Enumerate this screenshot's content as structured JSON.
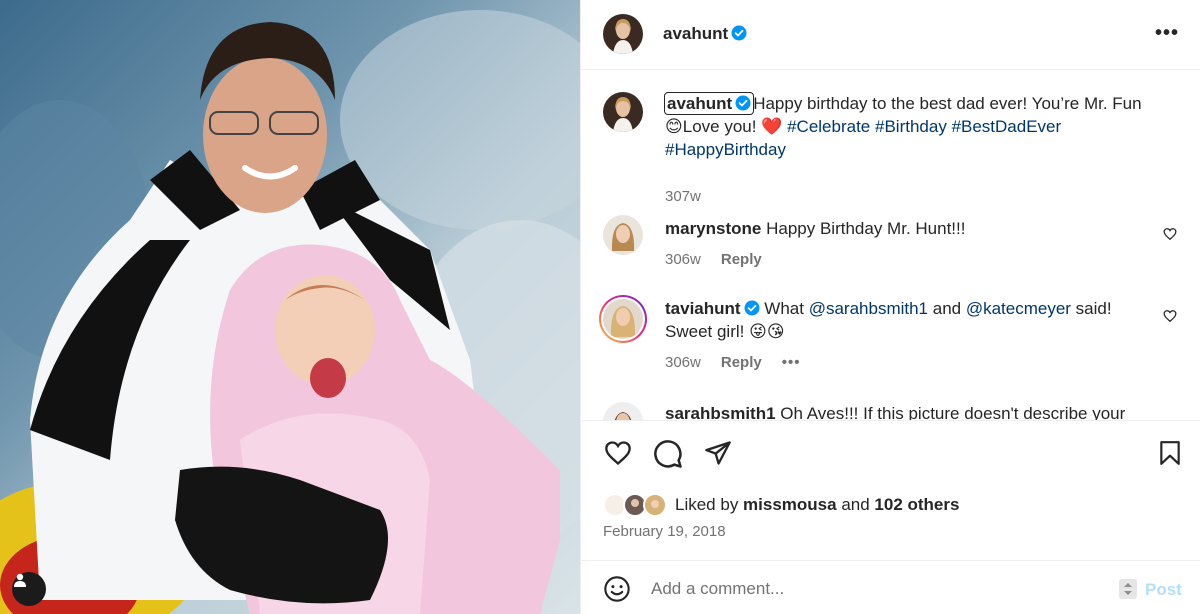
{
  "post": {
    "author": "avahunt",
    "caption_text": "Happy birthday to the best dad ever! You’re Mr. Fun ",
    "caption_emoji1": "😊",
    "caption_text2": "Love you! ",
    "caption_emoji2": "❤️",
    "hashtags": [
      "#Celebrate",
      "#Birthday",
      "#BestDadEver",
      "#HappyBirthday"
    ],
    "age": "307w",
    "liked_by_user": "missmousa",
    "likes_suffix": " and ",
    "likes_count": "102 others",
    "liked_by_prefix": "Liked by ",
    "date": "February 19, 2018"
  },
  "header": {
    "username": "avahunt",
    "more": "•••"
  },
  "comments": [
    {
      "username": "marynstone",
      "text": "Happy Birthday Mr. Hunt!!!",
      "age": "306w",
      "reply": "Reply"
    },
    {
      "username": "taviahunt",
      "text_prefix": "What ",
      "mention1": "@sarahbsmith1",
      "text_mid": " and ",
      "mention2": "@katecmeyer",
      "text_suffix": " said! Sweet girl! ",
      "emojis": "😜😘",
      "age": "306w",
      "reply": "Reply",
      "more": "•••"
    },
    {
      "username": "sarahbsmith1",
      "text": "Oh Aves!!! If this picture doesn't describe your"
    }
  ],
  "composer": {
    "placeholder": "Add a comment...",
    "post_label": "Post",
    "post_color": "#b2dffc"
  },
  "colors": {
    "verified": "#0095f6",
    "link": "#00376b",
    "muted": "#737373",
    "heart": "#ed4956"
  },
  "icons": {
    "like": "heart-icon",
    "comment": "comment-bubble-icon",
    "share": "paper-plane-icon",
    "save": "bookmark-icon",
    "emoji": "smiley-icon",
    "tag": "user-tag-icon"
  }
}
